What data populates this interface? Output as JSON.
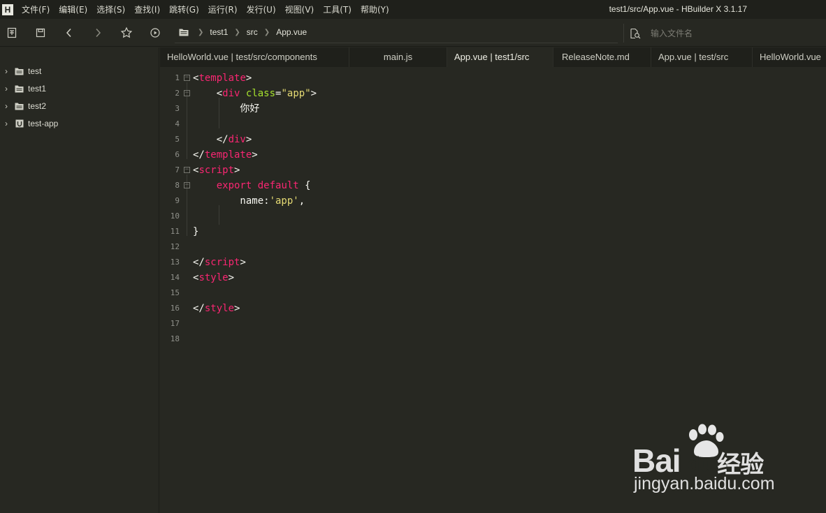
{
  "menubar": {
    "logo": "H",
    "items": [
      "文件(F)",
      "编辑(E)",
      "选择(S)",
      "查找(I)",
      "跳转(G)",
      "运行(R)",
      "发行(U)",
      "视图(V)",
      "工具(T)",
      "帮助(Y)"
    ],
    "window_title": "test1/src/App.vue - HBuilder X 3.1.17"
  },
  "toolbar": {
    "breadcrumb": [
      "test1",
      "src",
      "App.vue"
    ],
    "search_placeholder": "输入文件名"
  },
  "sidebar": {
    "items": [
      {
        "label": "test",
        "icon": "folder-icon"
      },
      {
        "label": "test1",
        "icon": "folder-icon"
      },
      {
        "label": "test2",
        "icon": "folder-icon"
      },
      {
        "label": "test-app",
        "icon": "uniapp-project-icon"
      }
    ]
  },
  "tabs": [
    {
      "label": "HelloWorld.vue | test/src/components",
      "active": false
    },
    {
      "label": "main.js",
      "active": false
    },
    {
      "label": "App.vue | test1/src",
      "active": true
    },
    {
      "label": "ReleaseNote.md",
      "active": false
    },
    {
      "label": "App.vue | test/src",
      "active": false
    },
    {
      "label": "HelloWorld.vue",
      "active": false
    }
  ],
  "editor": {
    "lines": [
      {
        "n": "1",
        "fold": true,
        "tokens": [
          [
            "br",
            "<"
          ],
          [
            "tag",
            "template"
          ],
          [
            "br",
            ">"
          ]
        ]
      },
      {
        "n": "2",
        "fold": true,
        "tokens": [
          [
            "txt",
            "    "
          ],
          [
            "br",
            "<"
          ],
          [
            "tag",
            "div"
          ],
          [
            "txt",
            " "
          ],
          [
            "attr",
            "class"
          ],
          [
            "br",
            "="
          ],
          [
            "str",
            "\"app\""
          ],
          [
            "br",
            ">"
          ]
        ]
      },
      {
        "n": "3",
        "fold": false,
        "tokens": [
          [
            "txt",
            "        你好"
          ]
        ]
      },
      {
        "n": "4",
        "fold": false,
        "tokens": []
      },
      {
        "n": "5",
        "fold": false,
        "tokens": [
          [
            "txt",
            "    "
          ],
          [
            "br",
            "</"
          ],
          [
            "tag",
            "div"
          ],
          [
            "br",
            ">"
          ]
        ]
      },
      {
        "n": "6",
        "fold": false,
        "tokens": [
          [
            "br",
            "</"
          ],
          [
            "tag",
            "template"
          ],
          [
            "br",
            ">"
          ]
        ]
      },
      {
        "n": "7",
        "fold": true,
        "tokens": [
          [
            "br",
            "<"
          ],
          [
            "tag",
            "script"
          ],
          [
            "br",
            ">"
          ]
        ]
      },
      {
        "n": "8",
        "fold": true,
        "tokens": [
          [
            "txt",
            "    "
          ],
          [
            "kw",
            "export"
          ],
          [
            "txt",
            " "
          ],
          [
            "kw",
            "default"
          ],
          [
            "txt",
            " {"
          ]
        ]
      },
      {
        "n": "9",
        "fold": false,
        "tokens": [
          [
            "txt",
            "        name:"
          ],
          [
            "str",
            "'app'"
          ],
          [
            "txt",
            ","
          ]
        ]
      },
      {
        "n": "10",
        "fold": false,
        "tokens": []
      },
      {
        "n": "11",
        "fold": false,
        "tokens": [
          [
            "txt",
            "}"
          ]
        ]
      },
      {
        "n": "12",
        "fold": false,
        "tokens": []
      },
      {
        "n": "13",
        "fold": false,
        "tokens": [
          [
            "br",
            "</"
          ],
          [
            "tag",
            "script"
          ],
          [
            "br",
            ">"
          ]
        ]
      },
      {
        "n": "14",
        "fold": false,
        "tokens": [
          [
            "br",
            "<"
          ],
          [
            "tag",
            "style"
          ],
          [
            "br",
            ">"
          ]
        ]
      },
      {
        "n": "15",
        "fold": false,
        "tokens": []
      },
      {
        "n": "16",
        "fold": false,
        "tokens": [
          [
            "br",
            "</"
          ],
          [
            "tag",
            "style"
          ],
          [
            "br",
            ">"
          ]
        ]
      },
      {
        "n": "17",
        "fold": false,
        "tokens": []
      },
      {
        "n": "18",
        "fold": false,
        "tokens": []
      }
    ]
  },
  "watermark": {
    "brand": "Bai",
    "brand_paw": "du",
    "brand_cn": "经验",
    "url": "jingyan.baidu.com"
  }
}
